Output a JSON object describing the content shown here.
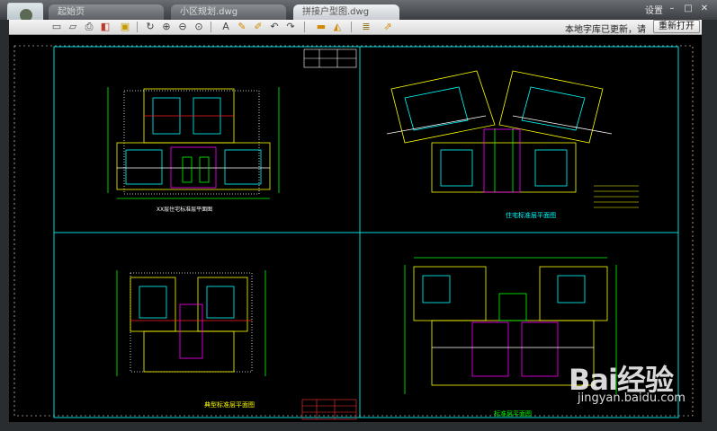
{
  "tabs": [
    {
      "label": "起始页"
    },
    {
      "label": "小区规划.dwg"
    },
    {
      "label": "拼接户型图.dwg"
    }
  ],
  "window": {
    "settings_label": "设置"
  },
  "toolbar": {
    "notice": "本地字库已更新，请",
    "reopen_label": "重新打开"
  },
  "drawing": {
    "titles": {
      "tl": "XX层住宅标准层平面图",
      "tr": "住宅标准层平面图",
      "bl": "典型标准层平面图",
      "br": "标准层平面图"
    }
  },
  "watermark": {
    "brand": "Bai经验",
    "url": "jingyan.baidu.com"
  }
}
